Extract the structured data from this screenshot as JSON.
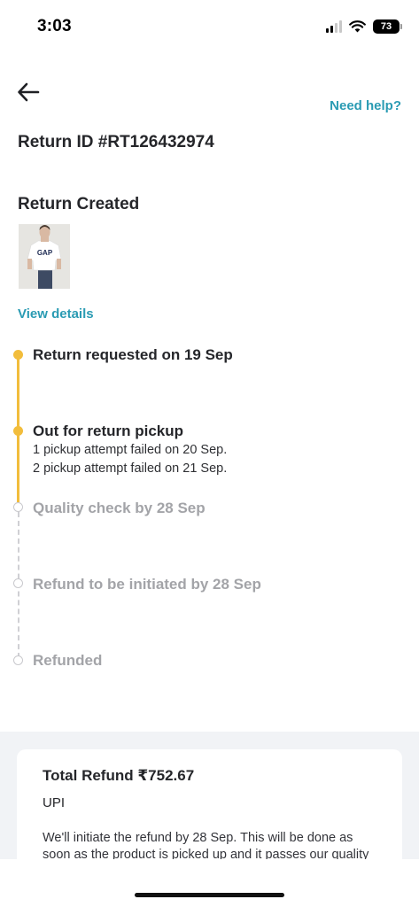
{
  "status_bar": {
    "time": "3:03",
    "battery": "73"
  },
  "header": {
    "back_icon": "arrow-left-icon",
    "help_label": "Need help?"
  },
  "return": {
    "id_label": "Return ID #RT126432974",
    "section_title": "Return Created",
    "product_image": "t-shirt-with-GAP-logo",
    "product_logo_text": "GAP",
    "view_details_label": "View details"
  },
  "timeline": {
    "steps": [
      {
        "title": "Return requested on 19 Sep",
        "state": "done",
        "notes": []
      },
      {
        "title": "Out for return pickup",
        "state": "done",
        "notes": [
          "1 pickup attempt failed on 20 Sep.",
          "2 pickup attempt failed on 21 Sep."
        ]
      },
      {
        "title": "Quality check by 28 Sep",
        "state": "pending",
        "notes": []
      },
      {
        "title": "Refund to be initiated by 28 Sep",
        "state": "pending",
        "notes": []
      },
      {
        "title": "Refunded",
        "state": "pending",
        "notes": []
      }
    ],
    "done_color": "#f2bd3c",
    "pending_color": "#c9c9cd"
  },
  "refund": {
    "total_label": "Total Refund ₹752.67",
    "method": "UPI",
    "note": "We'll initiate the refund by 28 Sep. This will be done as soon as the product is picked up and it passes our quality"
  },
  "colors": {
    "accent": "#2a9bb3",
    "text": "#25262a",
    "muted": "#a3a4a8"
  }
}
